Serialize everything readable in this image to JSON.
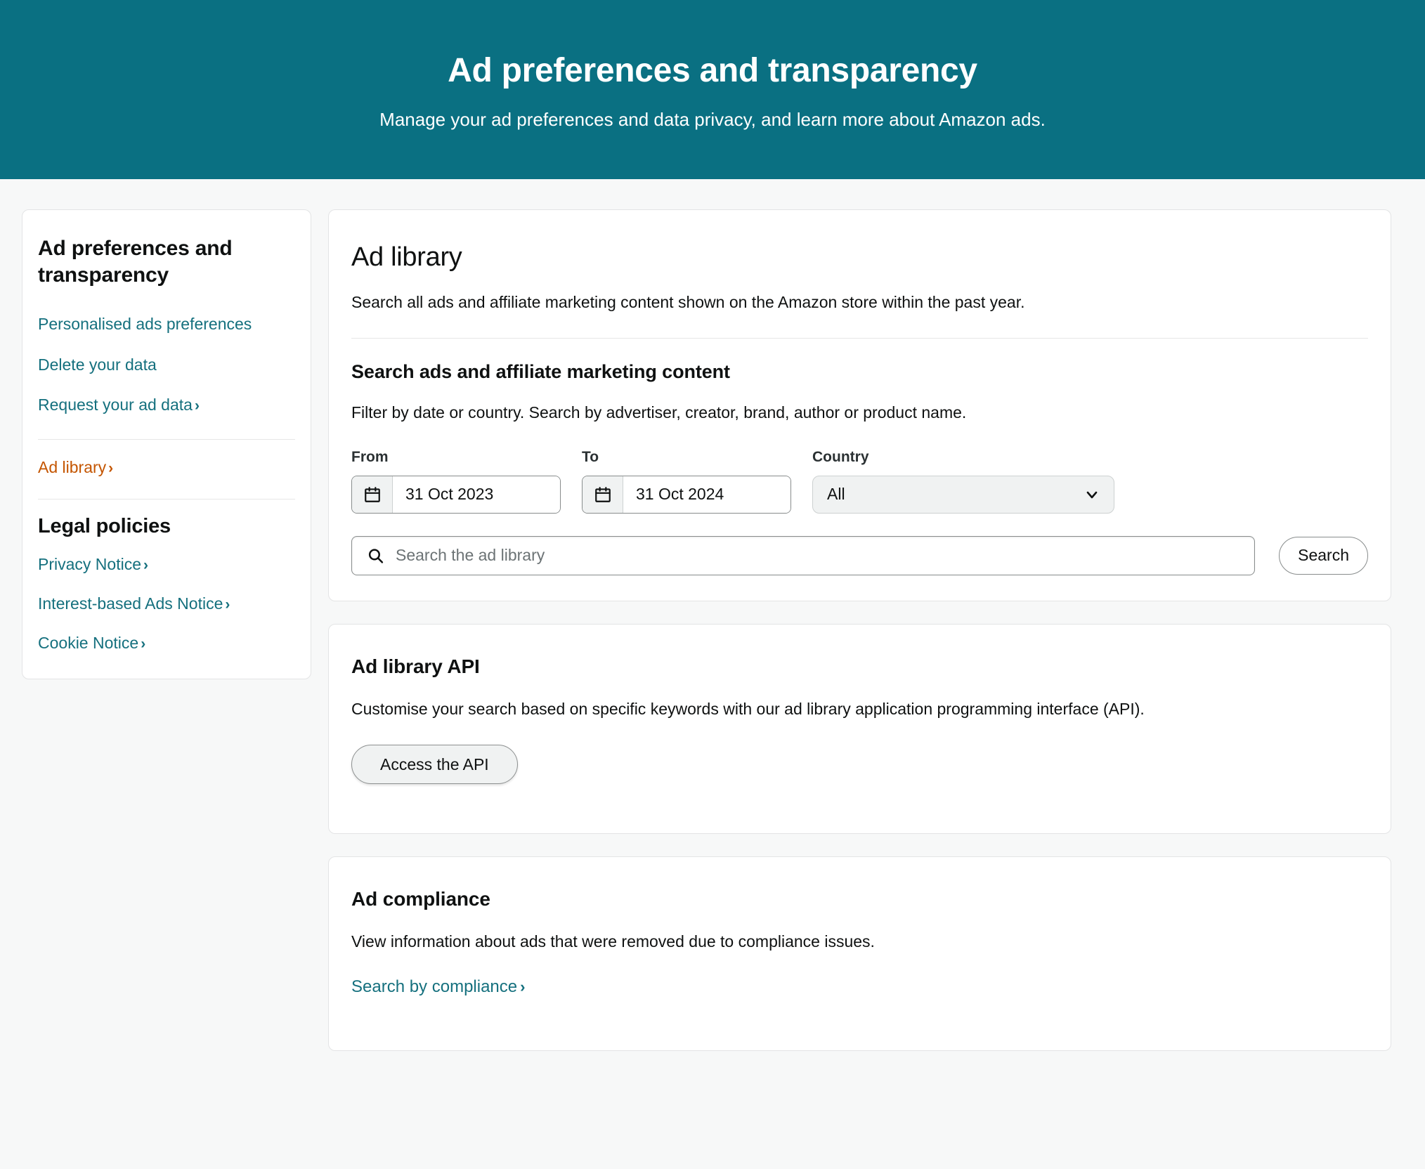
{
  "banner": {
    "title": "Ad preferences and transparency",
    "subtitle": "Manage your ad preferences and data privacy, and learn more about Amazon ads.",
    "background_color": "#0a7082"
  },
  "colors": {
    "banner_teal": "#0a7082",
    "link_teal": "#15707e",
    "active_orange": "#c45500",
    "page_background": "#f7f8f8",
    "card_background": "#ffffff",
    "card_border": "#e3e4e5",
    "text": "#0f1111"
  },
  "sidebar": {
    "title": "Ad preferences and transparency",
    "items": [
      {
        "label": "Personalised ads preferences",
        "chevron": "",
        "active": false
      },
      {
        "label": "Delete your data",
        "chevron": "",
        "active": false
      },
      {
        "label": "Request your ad data",
        "chevron": "›",
        "active": false
      },
      {
        "label": "Ad library",
        "chevron": "›",
        "active": true
      }
    ],
    "legal_heading": "Legal policies",
    "legal_items": [
      {
        "label": "Privacy Notice",
        "chevron": "›"
      },
      {
        "label": "Interest-based Ads Notice",
        "chevron": "›"
      },
      {
        "label": "Cookie Notice",
        "chevron": "›"
      }
    ]
  },
  "ad_library": {
    "title": "Ad library",
    "description": "Search all ads and affiliate marketing content shown on the Amazon store within the past year.",
    "section_title": "Search ads and affiliate marketing content",
    "section_description": "Filter by date or country. Search by advertiser, creator, brand, author or product name.",
    "filters": {
      "from_label": "From",
      "from_value": "31 Oct 2023",
      "to_label": "To",
      "to_value": "31 Oct 2024",
      "country_label": "Country",
      "country_value": "All",
      "country_options": [
        "All"
      ]
    },
    "search": {
      "placeholder": "Search the ad library",
      "value": "",
      "button_label": "Search"
    }
  },
  "ad_library_api": {
    "title": "Ad library API",
    "description": "Customise your search based on specific keywords with our ad library application programming interface (API).",
    "button_label": "Access the API"
  },
  "ad_compliance": {
    "title": "Ad compliance",
    "description": "View information about ads that were removed due to compliance issues.",
    "link_label": "Search by compliance",
    "link_chevron": "›"
  }
}
